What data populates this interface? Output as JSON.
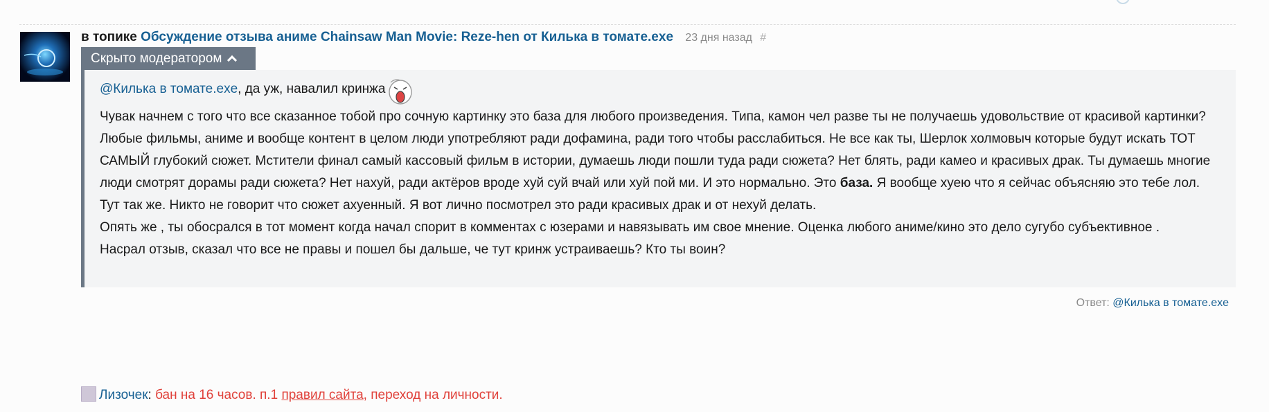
{
  "comment": {
    "header_prefix": "в топике",
    "topic_title": "Обсуждение отзыва аниме Chainsaw Man Movie: Reze-hen от Килька в томате.exe",
    "time_ago": "23 дня назад",
    "anchor": "#"
  },
  "moderation": {
    "label": "Скрыто модератором",
    "toggle_icon": "chevron-up-icon"
  },
  "body": {
    "mention": "@Килька в томате.exe",
    "mention_tail": ", да уж, навалил кринжа",
    "emoji": "smiley-emoji",
    "p1_before_bold": "Чувак начнем с того что все сказанное тобой про сочную картинку это база для любого произведения. Типа, камон чел разве ты не получаешь удовольствие от красивой картинки? Любые фильмы, аниме и вообще контент в целом люди употребляют ради дофамина, ради того чтобы расслабиться. Не все как ты, Шерлок холмовыч которые будут искать ТОТ САМЫЙ глубокий сюжет. Мстители финал самый кассовый фильм в истории, думаешь люди пошли туда ради сюжета? Нет блять, ради камео и красивых драк. Ты думаешь многие люди смотрят дорамы ради сюжета? Нет нахуй, ради актёров вроде хуй суй вчай или хуй пой ми. И это нормально. Это",
    "p1_bold": "база.",
    "p1_after_bold": "Я вообще хуею что я сейчас объясняю это тебе лол.",
    "p2": "Тут так же. Никто не говорит что сюжет ахуенный. Я вот лично посмотрел это ради красивых драк и от нехуй делать.",
    "p3": "Опять же , ты обосрался в тот момент когда начал спорит в комментах с юзерами и навязывать им свое мнение. Оценка любого аниме/кино это дело сугубо субъективное .",
    "p4": "Насрал отзыв, сказал что все не правы и пошел бы дальше, че тут кринж устраиваешь? Кто ты воин?"
  },
  "reply": {
    "label": "Ответ:",
    "target": "@Килька в томате.exe"
  },
  "ban_notice": {
    "moderator": "Лизочек",
    "colon": ":",
    "text_before_link": "бан на 16 часов. п.1",
    "link_text": "правил сайта",
    "text_after_link": ", переход на личности."
  },
  "colors": {
    "link": "#176093",
    "moderation_bg": "#6b7785",
    "quote_bg": "#f3f4f5",
    "ban_red": "#e0413a"
  }
}
